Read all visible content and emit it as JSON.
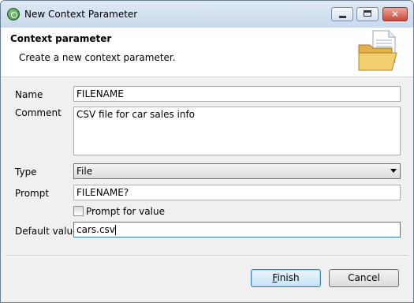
{
  "window": {
    "title": "New Context Parameter"
  },
  "header": {
    "title": "Context parameter",
    "description": "Create a new context parameter."
  },
  "form": {
    "name_label": "Name",
    "name_value": "FILENAME",
    "comment_label": "Comment",
    "comment_value": "CSV file for car sales info",
    "type_label": "Type",
    "type_value": "File",
    "prompt_label": "Prompt",
    "prompt_value": "FILENAME?",
    "prompt_for_value_label": "Prompt for value",
    "prompt_for_value_checked": false,
    "default_value_label": "Default value",
    "default_value": "cars.csv"
  },
  "buttons": {
    "finish_mnemonic": "F",
    "finish_rest": "inish",
    "cancel": "Cancel"
  }
}
